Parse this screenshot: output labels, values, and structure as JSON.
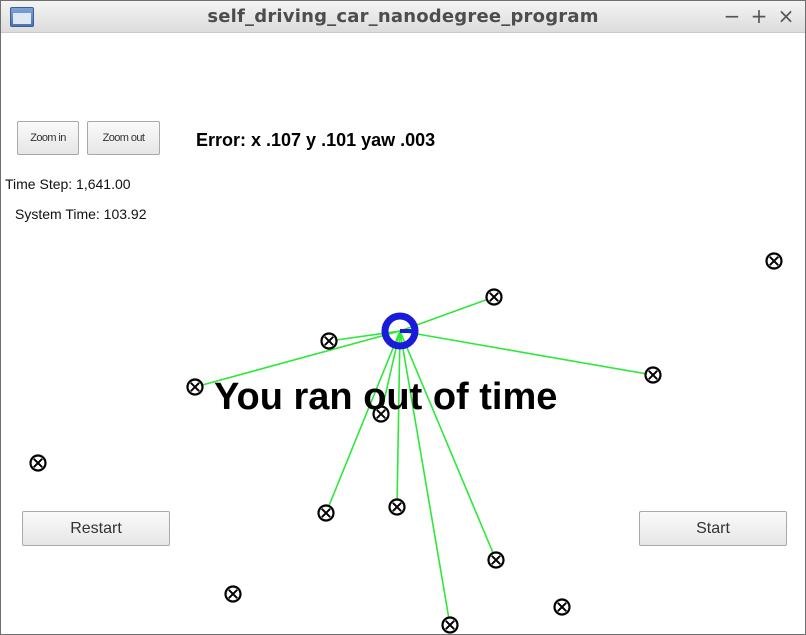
{
  "window": {
    "title": "self_driving_car_nanodegree_program",
    "controls": {
      "minimize": "−",
      "maximize": "+",
      "close": "×"
    }
  },
  "controls": {
    "zoom_in": "Zoom in",
    "zoom_out": "Zoom out",
    "restart": "Restart",
    "start": "Start"
  },
  "status": {
    "error": "Error: x .107 y .101 yaw .003",
    "time_step": "Time Step: 1,641.00",
    "system_time": "System Time: 103.92"
  },
  "message": "You ran out of time",
  "scene": {
    "vehicle_color": "#1a1adb",
    "observation_line_color": "#2ee83a",
    "landmark_icon": "circle-x-icon"
  }
}
